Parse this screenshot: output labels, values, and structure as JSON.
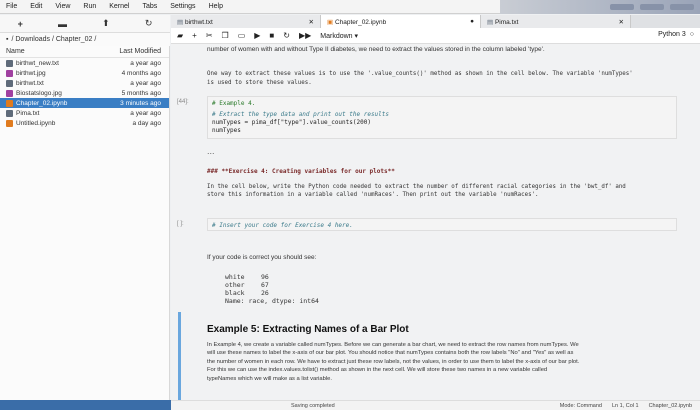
{
  "menu": [
    "File",
    "Edit",
    "View",
    "Run",
    "Kernel",
    "Tabs",
    "Settings",
    "Help"
  ],
  "breadcrumb": "/ Downloads / Chapter_02 /",
  "file_browser": {
    "col_name": "Name",
    "col_modified": "Last Modified",
    "files": [
      {
        "name": "birthwt_new.txt",
        "modified": "a year ago",
        "icon": "file-icon",
        "color": "#5f6b7a"
      },
      {
        "name": "birthwt.jpg",
        "modified": "4 months ago",
        "icon": "image-icon",
        "color": "#a040a0"
      },
      {
        "name": "birthwt.txt",
        "modified": "a year ago",
        "icon": "file-icon",
        "color": "#5f6b7a"
      },
      {
        "name": "Biostatslogo.jpg",
        "modified": "5 months ago",
        "icon": "image-icon",
        "color": "#a040a0"
      },
      {
        "name": "Chapter_02.ipynb",
        "modified": "3 minutes ago",
        "icon": "notebook-icon",
        "color": "#e07b1f",
        "selected": true
      },
      {
        "name": "Pima.txt",
        "modified": "a year ago",
        "icon": "file-icon",
        "color": "#5f6b7a"
      },
      {
        "name": "Untitled.ipynb",
        "modified": "a day ago",
        "icon": "notebook-icon",
        "color": "#e07b1f"
      }
    ]
  },
  "tabs": [
    {
      "label": "birthwt.txt"
    },
    {
      "label": "Chapter_02.ipynb"
    },
    {
      "label": "Pima.txt"
    }
  ],
  "toolbar": {
    "cell_type": "Markdown",
    "kernel": "Python 3"
  },
  "cells": {
    "md1_line1": "number of women with and without Type II diabetes, we need to extract the values stored in the column labeled 'type'.",
    "md2_line1": "One way to extract these values is to use the '.value_counts()' method as shown in the cell below. The variable 'numTypes'",
    "md2_line2": "is used to store these values.",
    "code1_prompt": "[44]:",
    "code1_l1": "# Example 4.",
    "code1_l2": "# Extract the type data and print out the results",
    "code1_l3": "numTypes = pima_df[\"type\"].value_counts(200)",
    "code1_l4": "numTypes",
    "ellipsis": "...",
    "ex_heading": "### **Exercise 4: Creating variables for our plots**",
    "ex_l1": "In the cell below, write the Python code needed to extract the number of different racial categories in the 'bwt_df' and",
    "ex_l2": "store this information in a variable called 'numRaces'. Then print out the variable 'numRaces'.",
    "code2_prompt": "[ ]:",
    "code2_l1": "# Insert your code for Exercise 4 here.",
    "correct_text": "If your code is correct you should see:",
    "out_rows": [
      {
        "label": "white",
        "value": "96"
      },
      {
        "label": "other",
        "value": "67"
      },
      {
        "label": "black",
        "value": "26"
      }
    ],
    "out_footer": "Name: race, dtype: int64",
    "ex5_heading": "Example 5: Extracting Names of a Bar Plot",
    "ex5_l1": "In Example 4, we create a variable called numTypes. Before we can generate a bar chart, we need to extract the row names from numTypes. We",
    "ex5_l2": "will use these names to label the x-axis of our bar plot. You should notice that numTypes contains both the row labels \"No\" and \"Yes\" as well as",
    "ex5_l3": "the number of women in each row. We have to extract just these row labels, not the values, in order to use them to label the x-axis of our bar plot.",
    "ex5_l4": "For this we can use the index.values.tolist() method as shown in the next cell. We will store these two names in a new variable called",
    "ex5_l5": "typeNames which we will make as a list variable."
  },
  "status": {
    "mode": "Mode: Command",
    "position": "Ln 1, Col 1",
    "file": "Chapter_02.ipynb",
    "saving": "Saving completed"
  }
}
